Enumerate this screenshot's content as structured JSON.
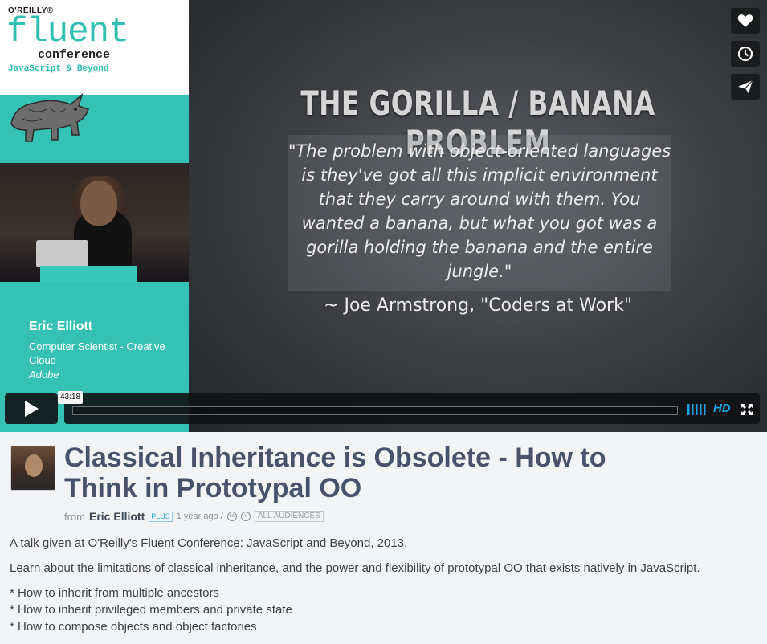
{
  "branding": {
    "publisher": "O'REILLY®",
    "name": "fluent",
    "conference": "conference",
    "tagline": "JavaScript & Beyond"
  },
  "presenter": {
    "name": "Eric Elliott",
    "role": "Computer Scientist - Creative Cloud",
    "org": "Adobe"
  },
  "slide": {
    "title": "THE GORILLA / BANANA PROBLEM",
    "quote": "\"The problem with object-oriented languages is they've got all this implicit environment that they carry around with them. You wanted a banana, but what you got was a gorilla holding the banana and the entire jungle.\"",
    "attribution": "~ Joe Armstrong, \"Coders at Work\""
  },
  "player": {
    "time": "43:18",
    "hd_label": "HD",
    "progress": 0.0,
    "side_buttons": [
      "heart-icon",
      "clock-icon",
      "send-icon"
    ],
    "accent_color": "#1aa3e0"
  },
  "video": {
    "title": "Classical Inheritance is Obsolete - How to Think in Prototypal OO",
    "from_label": "from",
    "author": "Eric Elliott",
    "author_badge": "PLUS",
    "posted": "1 year ago /",
    "audience": "ALL AUDIENCES"
  },
  "description": {
    "intro": "A talk given at O'Reilly's Fluent Conference: JavaScript and Beyond, 2013.",
    "body": "Learn about the limitations of classical inheritance, and the power and flexibility of prototypal OO that exists natively in JavaScript.",
    "bullets": [
      "* How to inherit from multiple ancestors",
      "* How to inherit privileged members and private state",
      "* How to compose objects and object factories"
    ]
  }
}
